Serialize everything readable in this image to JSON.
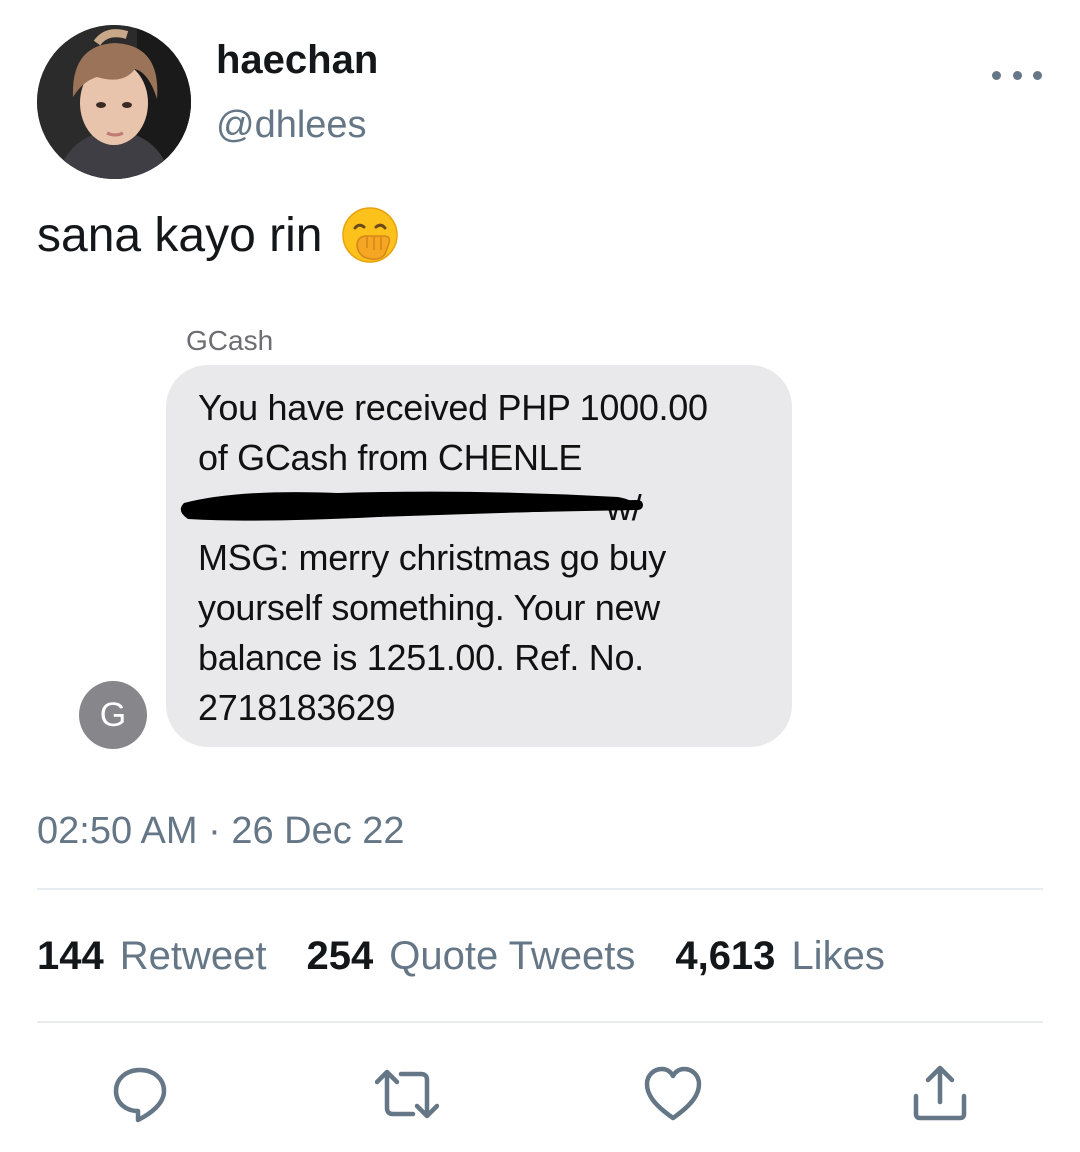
{
  "tweet": {
    "author": {
      "display_name": "haechan",
      "handle": "@dhlees"
    },
    "text": "sana kayo rin",
    "emoji": "face-with-hand-over-mouth",
    "timestamp": "02:50 AM · 26 Dec 22"
  },
  "media": {
    "sender": "GCash",
    "sender_initial": "G",
    "message_lines": [
      "You have received PHP 1000.00",
      "of GCash from CHENLE",
      "w/",
      "MSG: merry christmas go buy",
      "yourself something. Your new",
      "balance is 1251.00. Ref. No.",
      "2718183629"
    ]
  },
  "stats": [
    {
      "count": "144",
      "label": "Retweet"
    },
    {
      "count": "254",
      "label": "Quote Tweets"
    },
    {
      "count": "4,613",
      "label": "Likes"
    }
  ],
  "actions": [
    "reply-icon",
    "retweet-icon",
    "like-icon",
    "share-icon"
  ],
  "colors": {
    "text_primary": "#14171a",
    "text_secondary": "#657786",
    "bubble": "#e9e9eb",
    "divider": "#e6ecf0"
  }
}
